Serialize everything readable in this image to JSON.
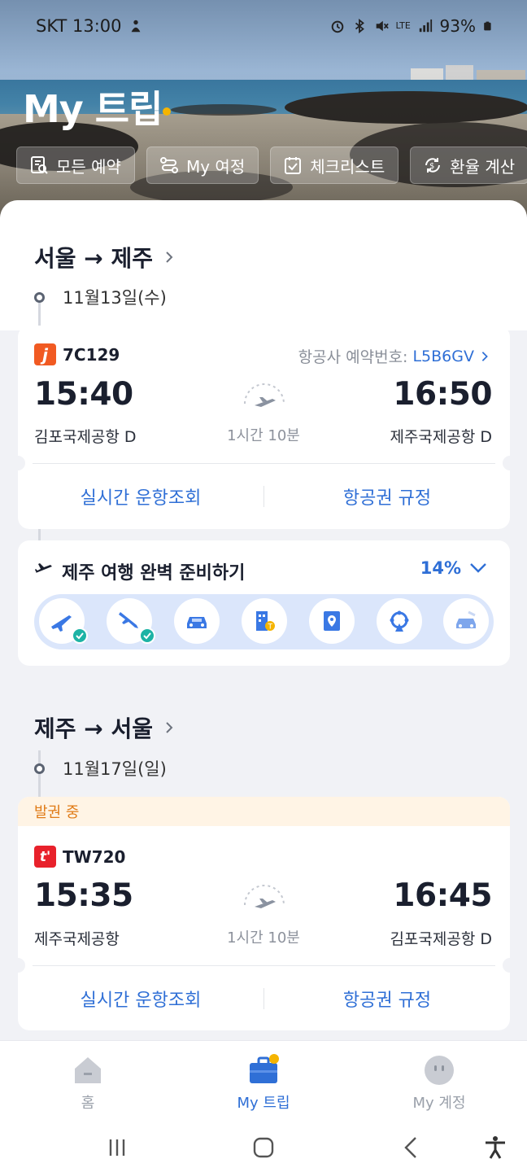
{
  "status_bar": {
    "carrier_time": "SKT 13:00",
    "network": "LTE",
    "battery": "93%"
  },
  "header": {
    "title": "My 트립",
    "quick_actions": [
      {
        "label": "모든 예약",
        "icon": "receipt-search-icon"
      },
      {
        "label": "My 여정",
        "icon": "route-icon"
      },
      {
        "label": "체크리스트",
        "icon": "checklist-icon"
      },
      {
        "label": "환율 계산",
        "icon": "currency-exchange-icon"
      }
    ]
  },
  "trips": [
    {
      "route": "서울 → 제주",
      "date": "11월13일(수)",
      "flight": {
        "airline_logo": "j",
        "logo_color": "#f15a22",
        "flight_no": "7C129",
        "booking_label": "항공사 예약번호:",
        "booking_code": "L5B6GV",
        "depart_time": "15:40",
        "depart_airport": "김포국제공항 D",
        "duration": "1시간 10분",
        "arrive_time": "16:50",
        "arrive_airport": "제주국제공항 D",
        "action_status": "실시간 운항조회",
        "action_rules": "항공권 규정"
      }
    },
    {
      "route": "제주 → 서울",
      "date": "11월17일(일)",
      "flight": {
        "status_banner": "발권 중",
        "airline_logo": "t'",
        "logo_color": "#e8212b",
        "flight_no": "TW720",
        "depart_time": "15:35",
        "depart_airport": "제주국제공항",
        "duration": "1시간 10분",
        "arrive_time": "16:45",
        "arrive_airport": "김포국제공항 D",
        "action_status": "실시간 운항조회",
        "action_rules": "항공권 규정"
      }
    }
  ],
  "prep": {
    "title": "제주 여행 완벽 준비하기",
    "percent": "14%",
    "percent_value": 14,
    "steps": [
      {
        "icon": "departure-flight-icon",
        "done": true
      },
      {
        "icon": "arrival-flight-icon",
        "done": true
      },
      {
        "icon": "car-rental-icon",
        "done": false
      },
      {
        "icon": "hotel-icon",
        "done": false
      },
      {
        "icon": "map-pin-icon",
        "done": false
      },
      {
        "icon": "activity-icon",
        "done": false
      },
      {
        "icon": "taxi-icon",
        "done": false
      }
    ]
  },
  "bottom_nav": [
    {
      "label": "홈",
      "icon": "home-icon",
      "active": false
    },
    {
      "label": "My 트립",
      "icon": "briefcase-icon",
      "active": true
    },
    {
      "label": "My 계정",
      "icon": "account-icon",
      "active": false
    }
  ],
  "colors": {
    "accent": "#2f6fd6",
    "issuing_bg": "#fff4e5",
    "issuing_text": "#e07b17",
    "check": "#1db3a5",
    "title_dot": "#f5b400"
  }
}
